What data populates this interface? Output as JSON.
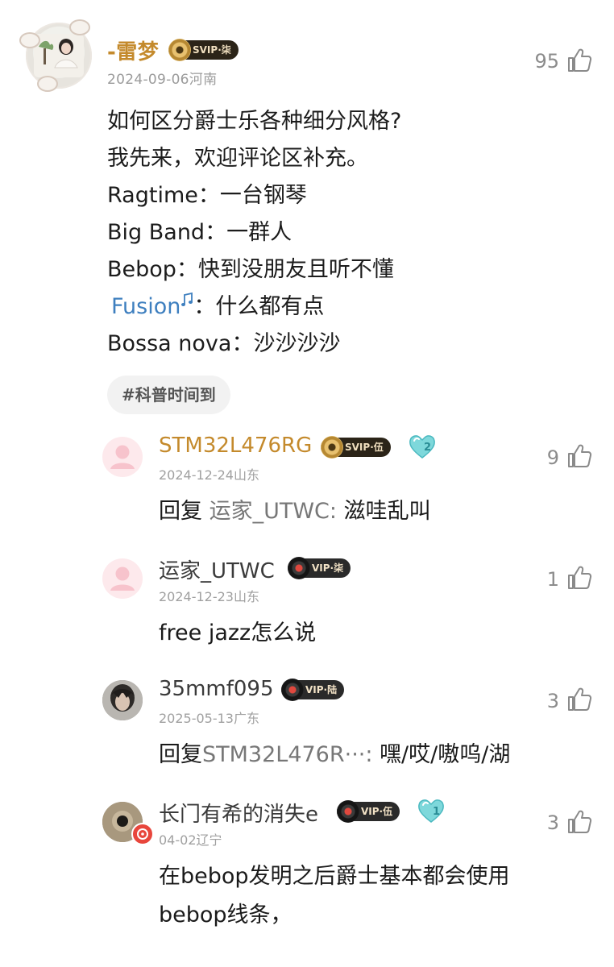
{
  "main_comment": {
    "user_name": "-雷梦",
    "vip_label": "SVIP·柒",
    "date": "2024-09-06",
    "location": "河南",
    "likes": "95",
    "lines": [
      "如何区分爵士乐各种细分风格?",
      "我先来，欢迎评论区补充。",
      "Ragtime：一台钢琴",
      "Big Band：一群人",
      "Bebop：快到没朋友且听不懂",
      "：什么都有点",
      "Bossa nova：沙沙沙沙"
    ],
    "fusion_link": "Fusion",
    "tag": "#科普时间到"
  },
  "replies": [
    {
      "user_name": "STM32L476RG",
      "vip_label": "SVIP·伍",
      "badge_number": "2",
      "date": "2024-12-24",
      "location": "山东",
      "likes": "9",
      "reply_prefix": "回复",
      "reply_target": "运家_UTWC:",
      "text": "滋哇乱叫"
    },
    {
      "user_name": "运家_UTWC",
      "vip_label": "VIP·柒",
      "date": "2024-12-23",
      "location": "山东",
      "likes": "1",
      "text": "free jazz怎么说"
    },
    {
      "user_name": "35mmf095",
      "vip_label": "VIP·陆",
      "date": "2025-05-13",
      "location": "广东",
      "likes": "3",
      "reply_prefix": "回复",
      "reply_target": "STM32L476R···:",
      "text": "嘿/哎/嗷呜/湖"
    },
    {
      "user_name": "长门有希的消失e",
      "vip_label": "VIP·伍",
      "badge_number": "1",
      "date": "04-02",
      "location": "辽宁",
      "likes": "3",
      "text_lines": [
        "在bebop发明之后爵士基本都会使用",
        "bebop线条，"
      ]
    }
  ],
  "colors": {
    "gold_name": "#c48a2c",
    "link_blue": "#3e7fbf",
    "meta_gray": "#9b9b9b",
    "heart_teal": "#6fd3d6"
  },
  "icons": [
    "thumbs-up-icon",
    "vinyl-disc-icon",
    "heart-level-badge-icon",
    "music-note-icon",
    "default-avatar-icon"
  ]
}
